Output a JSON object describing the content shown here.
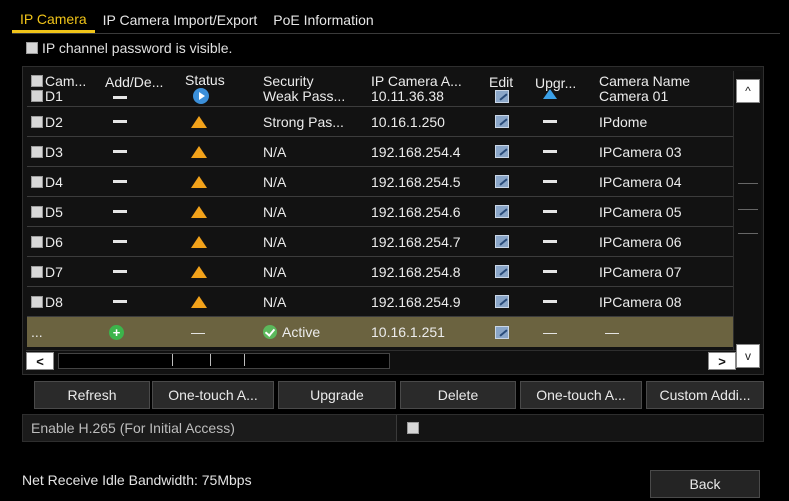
{
  "tabs": [
    {
      "label": "IP Camera",
      "active": true
    },
    {
      "label": "IP Camera Import/Export",
      "active": false
    },
    {
      "label": "PoE Information",
      "active": false
    }
  ],
  "password_visible": {
    "label": "IP channel password is visible.",
    "checked": false
  },
  "table": {
    "columns": {
      "camera_no": "Cam...",
      "add_delete": "Add/De...",
      "status": "Status",
      "security": "Security",
      "ip_address": "IP Camera A...",
      "edit": "Edit",
      "upgrade": "Upgr...",
      "camera_name": "Camera Name"
    },
    "first_row": {
      "camera_no": "D1",
      "add_delete_icon": "dash-icon",
      "status_icon": "play-icon",
      "security": "Weak Pass...",
      "ip_address": "10.11.36.38",
      "edit_icon": "edit-icon",
      "upgrade_icon": "upgrade-icon",
      "camera_name": "Camera 01"
    },
    "rows": [
      {
        "camera_no": "D2",
        "security": "Strong Pas...",
        "ip_address": "10.16.1.250",
        "camera_name": "IPdome"
      },
      {
        "camera_no": "D3",
        "security": "N/A",
        "ip_address": "192.168.254.4",
        "camera_name": "IPCamera 03"
      },
      {
        "camera_no": "D4",
        "security": "N/A",
        "ip_address": "192.168.254.5",
        "camera_name": "IPCamera 04"
      },
      {
        "camera_no": "D5",
        "security": "N/A",
        "ip_address": "192.168.254.6",
        "camera_name": "IPCamera 05"
      },
      {
        "camera_no": "D6",
        "security": "N/A",
        "ip_address": "192.168.254.7",
        "camera_name": "IPCamera 06"
      },
      {
        "camera_no": "D7",
        "security": "N/A",
        "ip_address": "192.168.254.8",
        "camera_name": "IPCamera 07"
      },
      {
        "camera_no": "D8",
        "security": "N/A",
        "ip_address": "192.168.254.9",
        "camera_name": "IPCamera 08"
      }
    ],
    "row_icons": {
      "add_delete": "dash-icon",
      "status": "warning-icon",
      "edit": "edit-icon",
      "upgrade": "dash-icon"
    },
    "discovered_row": {
      "camera_no": "...",
      "add_icon": "add-icon",
      "status": "—",
      "security": "Active",
      "security_icon": "check-icon",
      "ip_address": "10.16.1.251",
      "edit_icon": "edit-icon",
      "upgrade": "—",
      "camera_name": "—"
    }
  },
  "scrollbar": {
    "up": "^",
    "down": "v",
    "left": "<",
    "right": ">"
  },
  "buttons": {
    "refresh": "Refresh",
    "one_touch_activate": "One-touch A...",
    "upgrade": "Upgrade",
    "delete": "Delete",
    "one_touch_add": "One-touch A...",
    "custom_adding": "Custom Addi..."
  },
  "h265": {
    "label": "Enable H.265 (For Initial Access)",
    "checked": false
  },
  "bandwidth": "Net Receive Idle Bandwidth: 75Mbps",
  "back": "Back",
  "colors": {
    "accent": "#f0c419",
    "warning": "#f2a21a",
    "selected_row": "#6b6340",
    "add": "#3cb44b"
  }
}
